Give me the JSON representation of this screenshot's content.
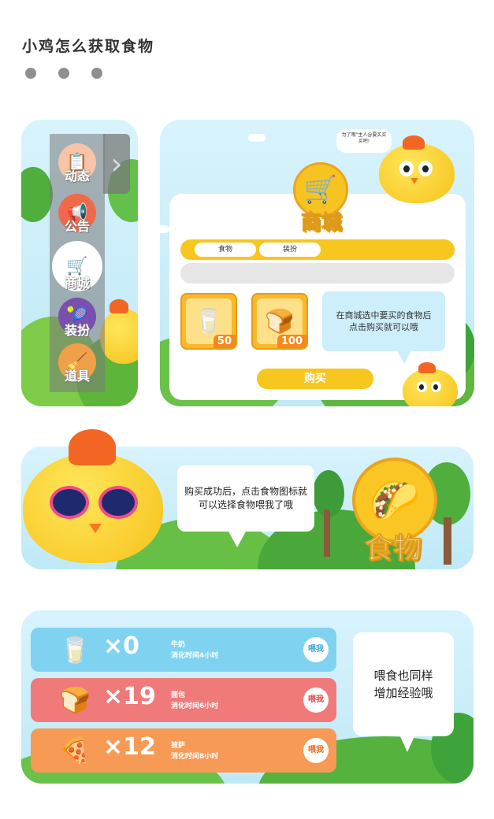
{
  "title": "小鸡怎么获取食物",
  "card1": {
    "arrow": "›",
    "menu": [
      {
        "label": "动态",
        "icon": "📋",
        "color": "#f7c4a8"
      },
      {
        "label": "公告",
        "icon": "📢",
        "color": "#f06a4a"
      },
      {
        "label": "商城",
        "icon": "🛒",
        "color": "#f7c622"
      },
      {
        "label": "装扮",
        "icon": "🎾",
        "color": "#7a4fb0"
      },
      {
        "label": "道具",
        "icon": "🧹",
        "color": "#f0a048"
      }
    ]
  },
  "card2": {
    "bubble_text": "为了哦\"主人@要买买买吧!",
    "shop_title": "商城",
    "tabs": [
      "食物",
      "装扮"
    ],
    "items": [
      {
        "name": "milk",
        "icon": "🥛",
        "price": "50"
      },
      {
        "name": "bread",
        "icon": "🍞",
        "price": "100"
      }
    ],
    "tip": "在商城选中要买的食物后\n点击购买就可以哦",
    "buy_label": "购买"
  },
  "card3": {
    "bubble": "购买成功后，点击食物图标就\n可以选择食物喂我了哦",
    "food_icon": "🌮",
    "food_label": "食物"
  },
  "card4": {
    "rows": [
      {
        "icon": "🥛",
        "count": "×0",
        "name": "牛奶",
        "time": "消化时间4小时",
        "feed": "喂我",
        "color": "#7fd3f0",
        "btn_color": "#3aa8d8"
      },
      {
        "icon": "🍞",
        "count": "×19",
        "name": "面包",
        "time": "消化时间6小时",
        "feed": "喂我",
        "color": "#f07a7a",
        "btn_color": "#e04a4a"
      },
      {
        "icon": "🍕",
        "count": "×12",
        "name": "披萨",
        "time": "消化时间8小时",
        "feed": "喂我",
        "color": "#f79a56",
        "btn_color": "#e86a1a"
      }
    ],
    "note": "喂食也同样\n增加经验哦"
  }
}
